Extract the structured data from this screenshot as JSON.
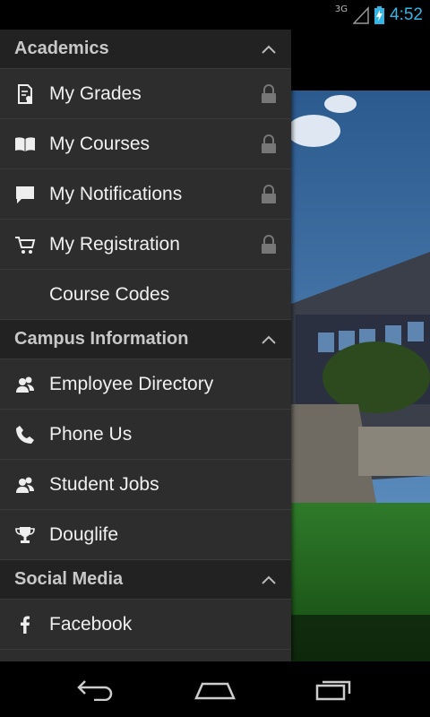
{
  "status": {
    "network": "3G",
    "time": "4:52",
    "accent": "#33b5e5"
  },
  "sections": [
    {
      "title": "Academics",
      "items": [
        {
          "label": "My Grades",
          "icon": "grades-icon",
          "locked": true
        },
        {
          "label": "My Courses",
          "icon": "book-icon",
          "locked": true
        },
        {
          "label": "My Notifications",
          "icon": "chat-bubble-icon",
          "locked": true
        },
        {
          "label": "My Registration",
          "icon": "cart-icon",
          "locked": true
        },
        {
          "label": "Course Codes",
          "icon": "",
          "locked": false
        }
      ]
    },
    {
      "title": "Campus Information",
      "items": [
        {
          "label": "Employee Directory",
          "icon": "people-icon",
          "locked": false
        },
        {
          "label": "Phone Us",
          "icon": "phone-icon",
          "locked": false
        },
        {
          "label": "Student Jobs",
          "icon": "people-icon",
          "locked": false
        },
        {
          "label": "Douglife",
          "icon": "trophy-icon",
          "locked": false
        }
      ]
    },
    {
      "title": "Social Media",
      "items": [
        {
          "label": "Facebook",
          "icon": "facebook-icon",
          "locked": false
        }
      ]
    }
  ],
  "navbar": {
    "buttons": [
      "back-icon",
      "home-icon",
      "recent-apps-icon"
    ]
  }
}
